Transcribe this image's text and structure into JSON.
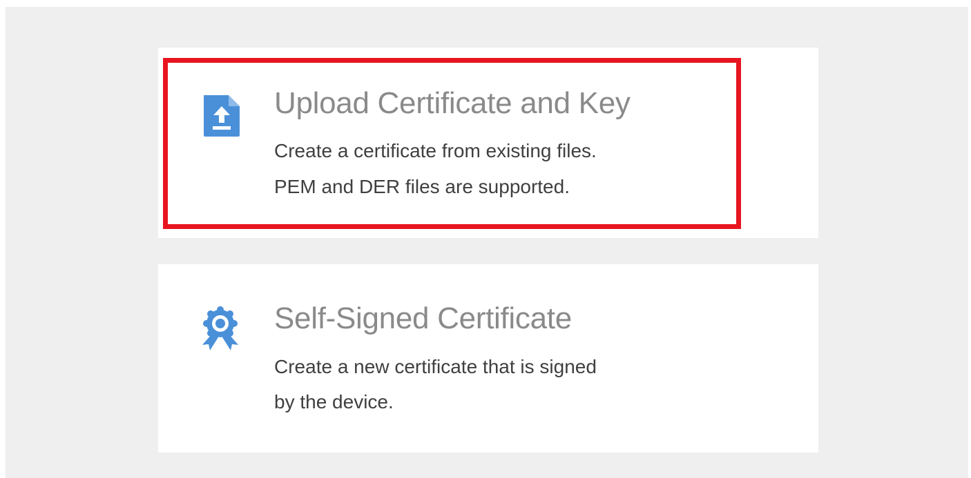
{
  "options": [
    {
      "title": "Upload Certificate and Key",
      "description_lines": [
        "Create a certificate from existing files.",
        "PEM and DER files are supported."
      ],
      "icon": "upload-file-icon",
      "highlighted": true
    },
    {
      "title": "Self-Signed Certificate",
      "description_lines": [
        "Create a new certificate that is signed",
        "by the device."
      ],
      "icon": "certificate-badge-icon",
      "highlighted": false
    }
  ],
  "colors": {
    "background": "#efefef",
    "card": "#ffffff",
    "icon_blue": "#4a90d9",
    "highlight": "#e8141f",
    "title_text": "#8a8a8a",
    "description_text": "#3f3f3f"
  }
}
